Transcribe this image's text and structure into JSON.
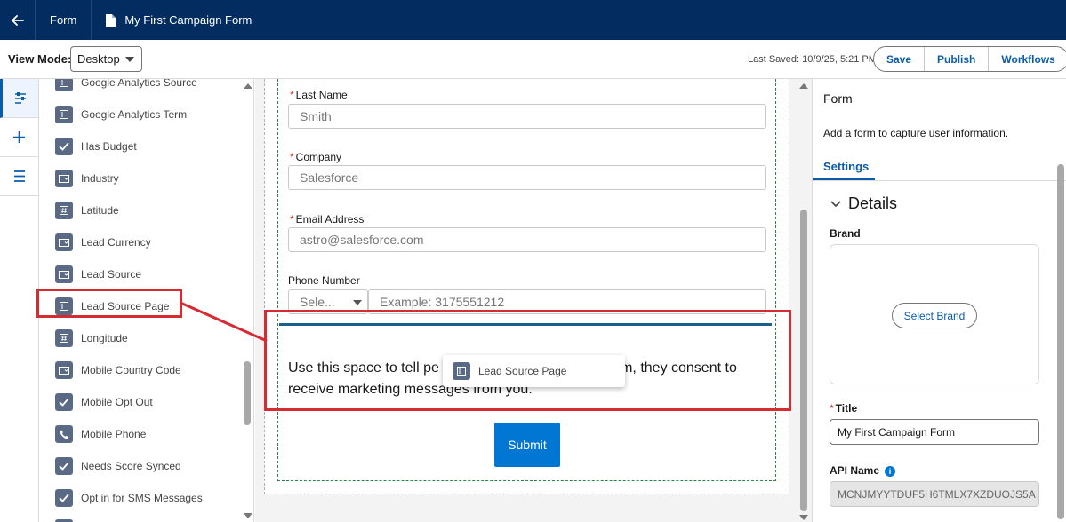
{
  "topbar": {
    "crumb": "Form",
    "title": "My First Campaign Form"
  },
  "toolbar": {
    "view_mode_label": "View Mode:",
    "view_mode_value": "Desktop",
    "last_saved": "Last Saved: 10/9/25, 5:21 PM",
    "buttons": [
      "Save",
      "Publish",
      "Workflows"
    ]
  },
  "field_list": [
    {
      "label": "Google Analytics Source",
      "icon": "text-field-icon"
    },
    {
      "label": "Google Analytics Term",
      "icon": "text-field-icon"
    },
    {
      "label": "Has Budget",
      "icon": "checkbox-icon"
    },
    {
      "label": "Industry",
      "icon": "picklist-icon"
    },
    {
      "label": "Latitude",
      "icon": "number-icon"
    },
    {
      "label": "Lead Currency",
      "icon": "picklist-icon"
    },
    {
      "label": "Lead Source",
      "icon": "picklist-icon"
    },
    {
      "label": "Lead Source Page",
      "icon": "text-field-icon"
    },
    {
      "label": "Longitude",
      "icon": "number-icon"
    },
    {
      "label": "Mobile Country Code",
      "icon": "picklist-icon"
    },
    {
      "label": "Mobile Opt Out",
      "icon": "checkbox-icon"
    },
    {
      "label": "Mobile Phone",
      "icon": "phone-icon"
    },
    {
      "label": "Needs Score Synced",
      "icon": "checkbox-icon"
    },
    {
      "label": "Opt in for SMS Messages",
      "icon": "checkbox-icon"
    }
  ],
  "form": {
    "last_name": {
      "label": "Last Name",
      "placeholder": "Smith"
    },
    "company": {
      "label": "Company",
      "placeholder": "Salesforce"
    },
    "email": {
      "label": "Email Address",
      "placeholder": "astro@salesforce.com"
    },
    "phone": {
      "label": "Phone Number",
      "select": "Sele...",
      "placeholder": "Example: 3175551212"
    },
    "consent_line1": "Use this space to tell pe",
    "consent_line1_end": "orm, they consent to",
    "consent_line2": "receive marketing messages from you.",
    "submit": "Submit",
    "drag_ghost": "Lead Source Page"
  },
  "panel": {
    "title": "Form",
    "description": "Add a form to capture user information.",
    "tab": "Settings",
    "section": "Details",
    "brand_label": "Brand",
    "select_brand": "Select Brand",
    "title_label": "Title",
    "title_value": "My First Campaign Form",
    "api_label": "API Name",
    "api_value": "MCNJMYYTDUF5H6TMLX7XZDUOJS5A"
  },
  "colors": {
    "header": "#032d60",
    "accent": "#0b5cab",
    "button": "#0176d3",
    "annotation": "#d62b32"
  }
}
